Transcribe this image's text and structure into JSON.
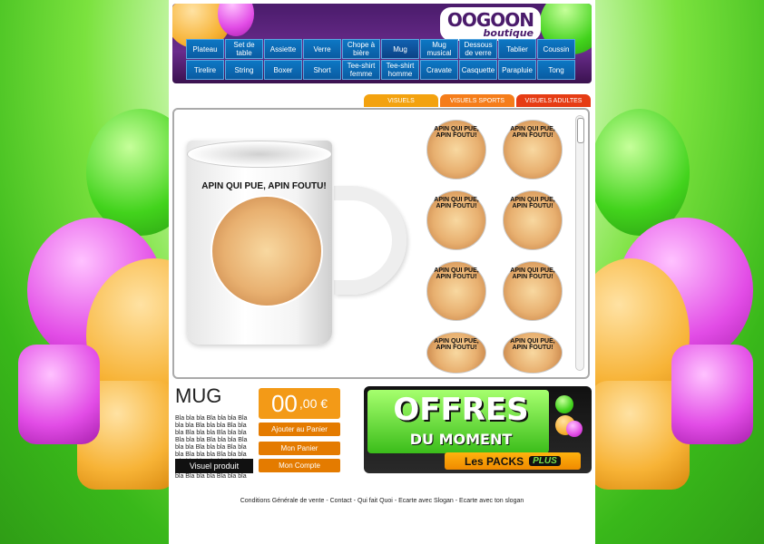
{
  "logo": {
    "brand": "OOGOON",
    "sub": "boutique"
  },
  "nav": {
    "row1": [
      "Plateau",
      "Set de table",
      "Assiette",
      "Verre",
      "Chope à bière",
      "Mug",
      "Mug musical",
      "Dessous de verre",
      "Tablier",
      "Coussin"
    ],
    "row2": [
      "Tirelire",
      "String",
      "Boxer",
      "Short",
      "Tee-shirt femme",
      "Tee-shirt homme",
      "Cravate",
      "Casquette",
      "Parapluie",
      "Tong"
    ]
  },
  "tabs": [
    {
      "label": "VISUELS",
      "color": "#f3a20f"
    },
    {
      "label": "VISUELS SPORTS",
      "color": "#f57d1a"
    },
    {
      "label": "VISUELS ADULTES",
      "color": "#e63c14"
    }
  ],
  "product": {
    "title": "MUG",
    "description": "Bla bla bla Bla bla bla Bla bla bla Bla bla bla Bla bla bla Bla bla bla Bla bla bla Bla bla bla Bla bla bla Bla bla bla Bla bla bla Bla bla bla Bla bla bla Bla bla bla Bla bla bla Bla bla bla Bla bla bla Bla bla bla Bla bla bla Bla bla bla Bla bla bla",
    "visuel_button": "Visuel produit",
    "print_text": "APIN QUI PUE, APIN FOUTU!"
  },
  "price": {
    "int": "00",
    "dec": ",00 €"
  },
  "actions": {
    "add_to_cart": "Ajouter au Panier",
    "my_cart": "Mon Panier",
    "my_account": "Mon Compte"
  },
  "promo": {
    "title": "OFFRES",
    "subtitle": "DU MOMENT",
    "packs": "Les PACKS",
    "plus": "PLUS"
  },
  "thumbs_text": "APIN QUI PUE, APIN FOUTU!",
  "footer": [
    "Conditions Générale de vente",
    "Contact",
    "Qui fait Quoi",
    "Ecarte avec Slogan",
    "Ecarte avec ton slogan"
  ]
}
